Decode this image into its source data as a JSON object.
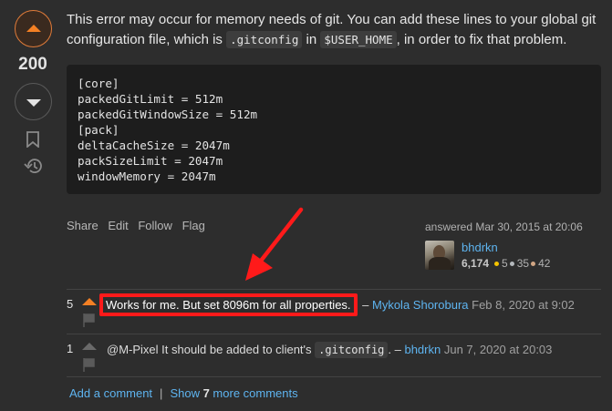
{
  "vote": {
    "score": "200"
  },
  "answer": {
    "text_before_1": "This error may occur for memory needs of git. You can add these lines to your global git configuration file, which is ",
    "code_1": ".gitconfig",
    "text_between": " in ",
    "code_2": "$USER_HOME",
    "text_after": ", in order to fix that problem.",
    "code_block": "[core]\npackedGitLimit = 512m\npackedGitWindowSize = 512m\n[pack]\ndeltaCacheSize = 2047m\npackSizeLimit = 2047m\nwindowMemory = 2047m"
  },
  "post_menu": {
    "share": "Share",
    "edit": "Edit",
    "follow": "Follow",
    "flag": "Flag"
  },
  "signature": {
    "action_time": "answered Mar 30, 2015 at 20:06",
    "user_name": "bhdrkn",
    "reputation": "6,174",
    "gold": "5",
    "silver": "35",
    "bronze": "42"
  },
  "comments": [
    {
      "score": "5",
      "text": "Works for me. But set 8096m for all properties.",
      "sep": " – ",
      "user": "Mykola Shorobura",
      "date": "Feb 8, 2020 at 9:02"
    },
    {
      "score": "1",
      "text_before": "@M-Pixel It should be added to client's ",
      "code": ".gitconfig",
      "text_after": ". – ",
      "user": "bhdrkn",
      "date": "Jun 7, 2020 at 20:03"
    }
  ],
  "comment_actions": {
    "add": "Add a comment",
    "sep": "|",
    "show_prefix": "Show ",
    "show_count": "7",
    "show_suffix": " more comments"
  },
  "colors": {
    "accent": "#f48024",
    "link": "#5eb4f0",
    "highlight": "#ff1a1a"
  }
}
